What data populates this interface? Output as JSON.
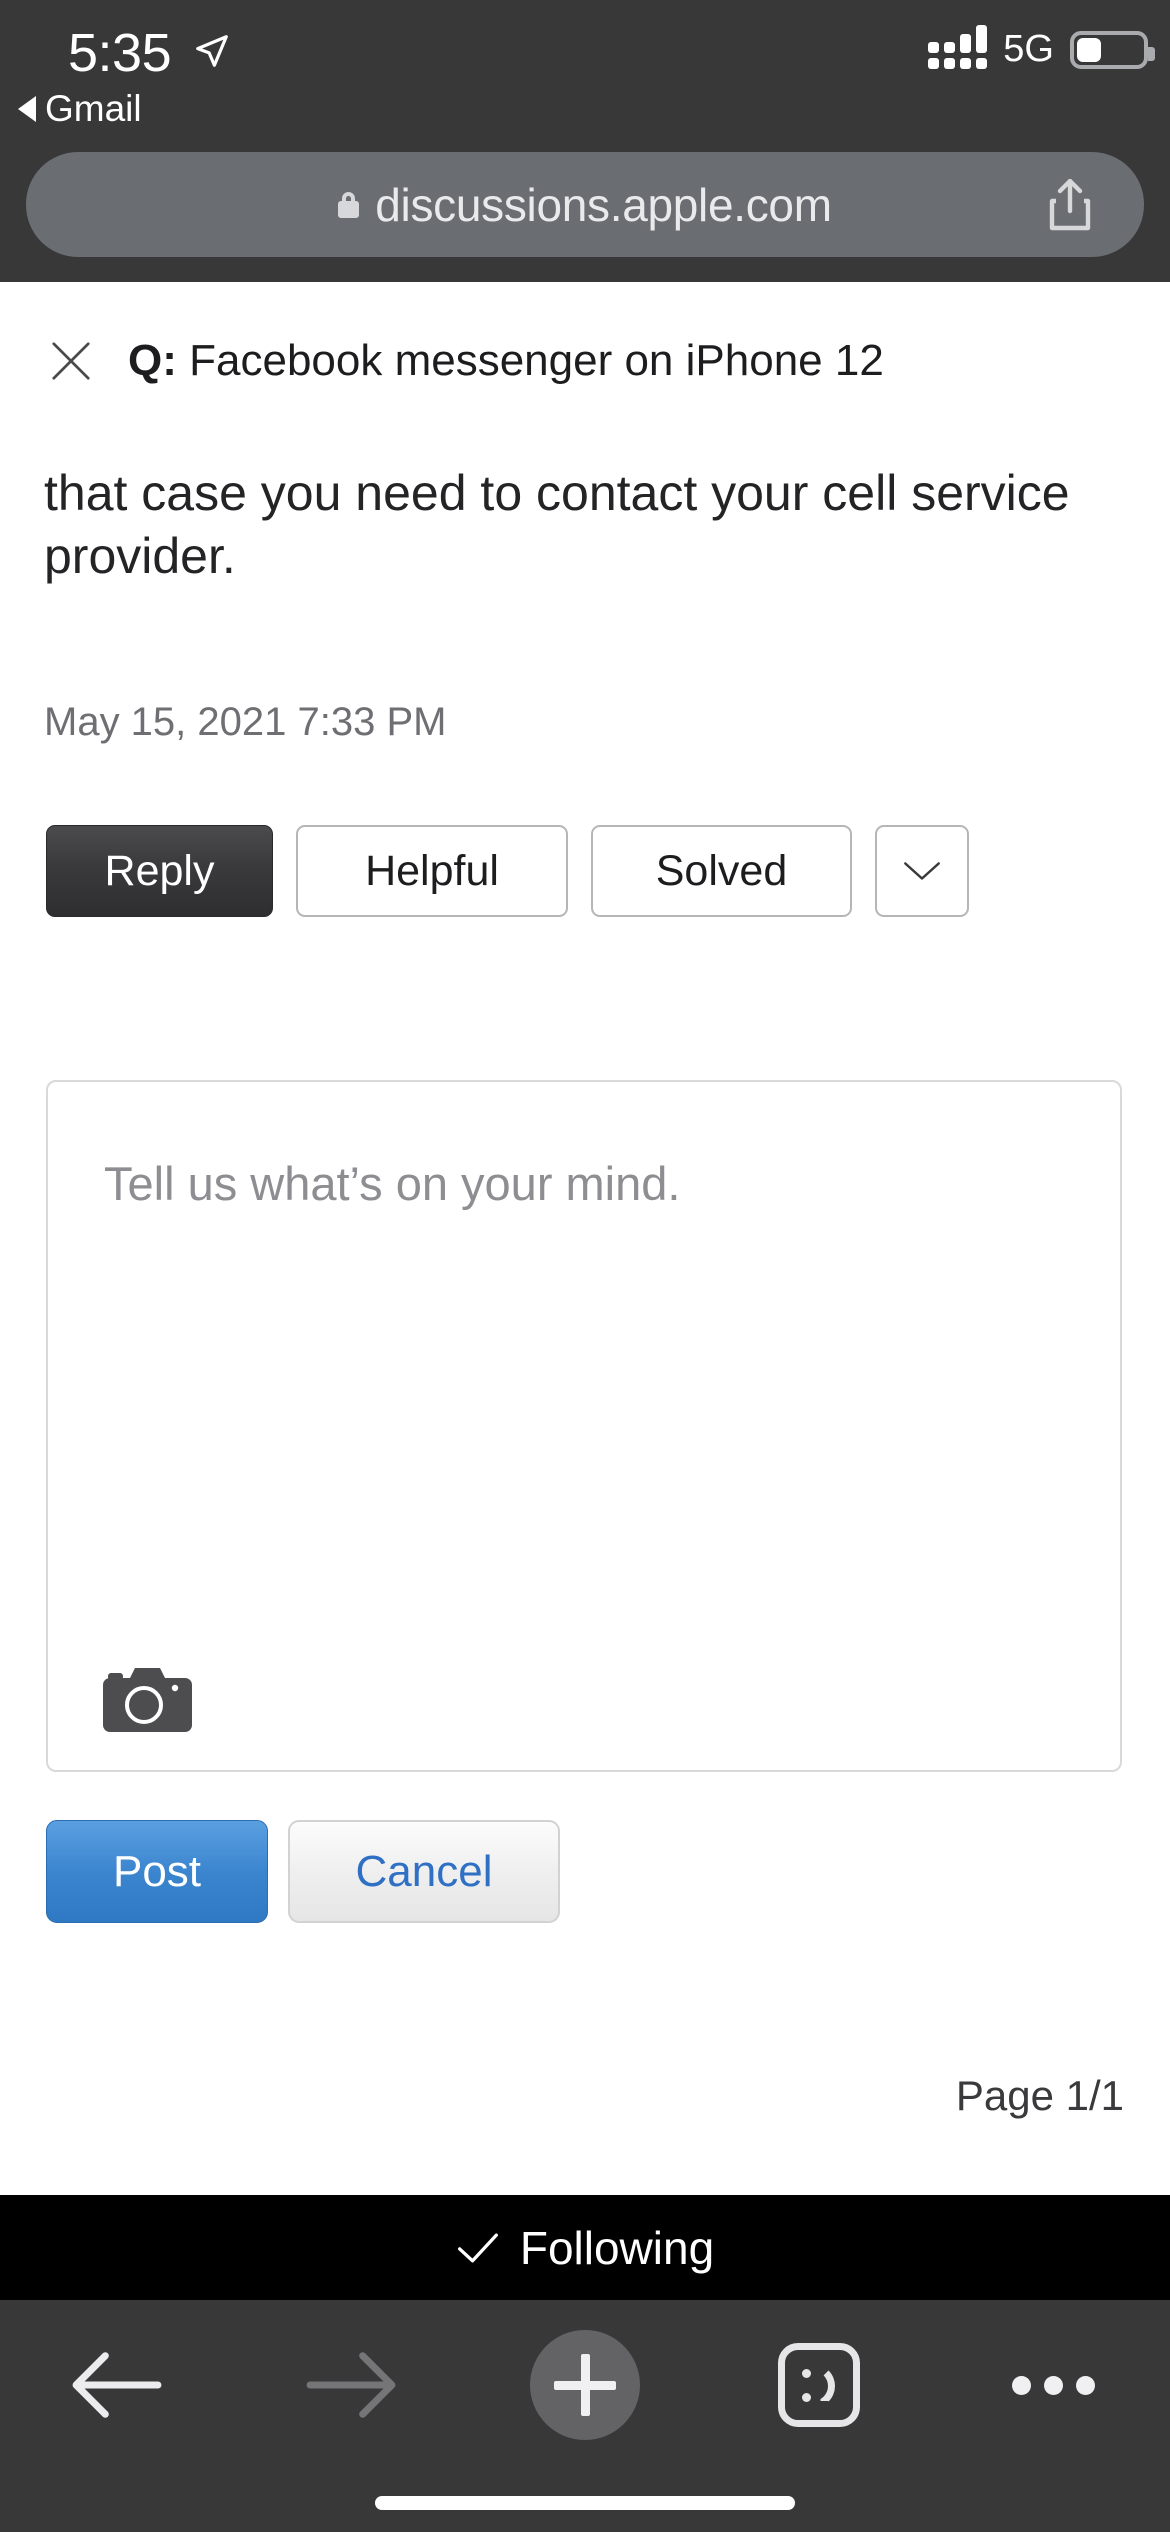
{
  "status_bar": {
    "time": "5:35",
    "location_icon": "location-arrow-icon",
    "back_app_label": "Gmail",
    "back_icon": "back-triangle-icon",
    "signal_icon": "cellular-signal-icon",
    "network": "5G",
    "battery_icon": "battery-icon",
    "battery_percent": 30
  },
  "browser": {
    "lock_icon": "lock-icon",
    "url": "discussions.apple.com",
    "share_icon": "share-icon"
  },
  "question_header": {
    "close_icon": "close-x-icon",
    "prefix": "Q:",
    "title": "Facebook messenger on iPhone 12"
  },
  "post": {
    "body": "that case you need to contact your cell service provider.",
    "date": "May 15, 2021 7:33 PM",
    "actions": {
      "reply": "Reply",
      "helpful": "Helpful",
      "solved": "Solved",
      "more_icon": "chevron-down-icon"
    }
  },
  "composer": {
    "placeholder": "Tell us what’s on your mind.",
    "value": "",
    "camera_icon": "camera-icon",
    "post_label": "Post",
    "cancel_label": "Cancel"
  },
  "pagination": {
    "label": "Page 1/1"
  },
  "following_bar": {
    "check_icon": "checkmark-icon",
    "label": "Following"
  },
  "toolbar": {
    "back_icon": "arrow-left-icon",
    "forward_icon": "arrow-right-icon",
    "add_icon": "plus-icon",
    "smiley_icon": "smiley-sticker-icon",
    "more_icon": "ellipsis-icon",
    "home_indicator": "home-indicator"
  },
  "colors": {
    "chrome_bg": "#383838",
    "urlbar_bg": "#6a6d72",
    "accent_blue": "#3b85cf",
    "link_blue": "#2f6fc4",
    "following_bg": "#000000",
    "reply_bg": "#3a3a3c"
  }
}
